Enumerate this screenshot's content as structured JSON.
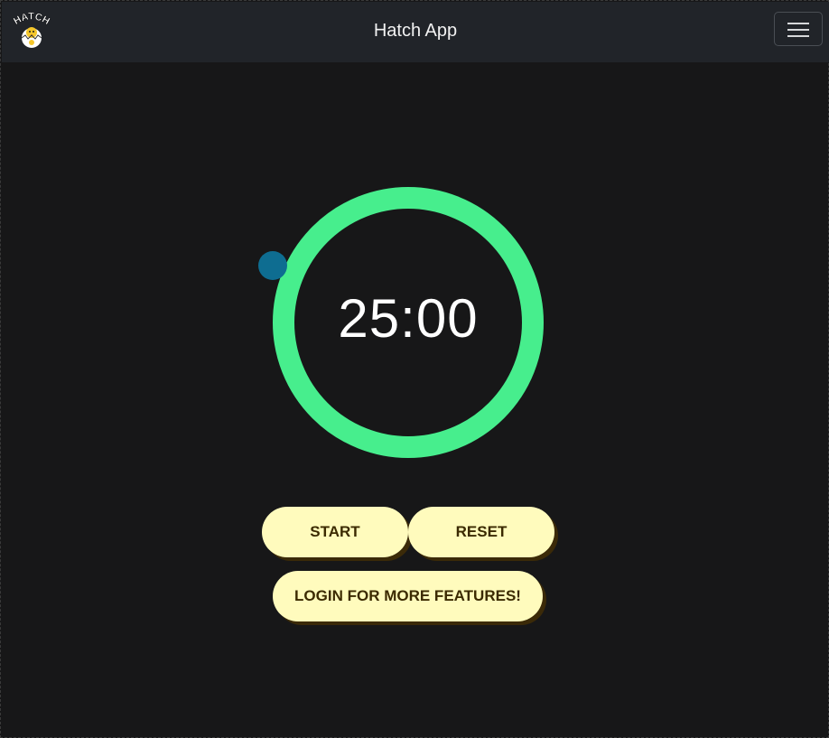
{
  "navbar": {
    "logo_text": "HATCH",
    "title": "Hatch App",
    "menu_icon": "hamburger-menu-icon"
  },
  "timer": {
    "time": "25:00",
    "progress": 1.0,
    "ring_color": "#47ee8d",
    "handle_color": "#0e6d91"
  },
  "controls": {
    "start_label": "START",
    "reset_label": "RESET",
    "login_label": "LOGIN FOR MORE FEATURES!"
  },
  "colors": {
    "background": "#171718",
    "navbar": "#212429",
    "button_bg": "#fffbbd",
    "button_text": "#3b2a00"
  }
}
